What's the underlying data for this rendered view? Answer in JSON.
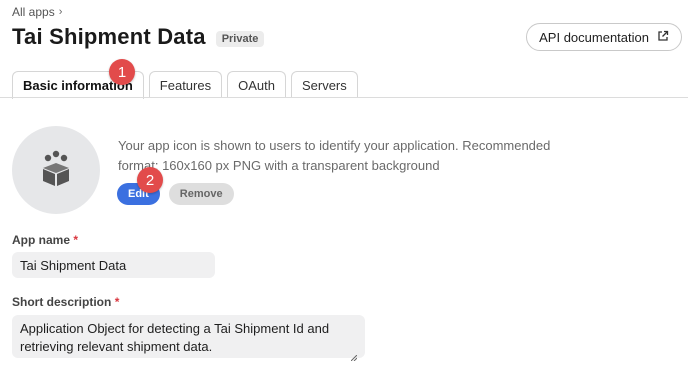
{
  "breadcrumb": {
    "label": "All apps",
    "chevron": "›"
  },
  "title": "Tai Shipment Data",
  "badge": "Private",
  "api_button": {
    "label": "API documentation",
    "icon": "external-link-icon"
  },
  "tabs": [
    {
      "label": "Basic information",
      "active": true
    },
    {
      "label": "Features",
      "active": false
    },
    {
      "label": "OAuth",
      "active": false
    },
    {
      "label": "Servers",
      "active": false
    }
  ],
  "markers": [
    "1",
    "2"
  ],
  "app_icon": {
    "description": "Your app icon is shown to users to identify your application. Recommended format: 160x160 px PNG with a transparent background",
    "edit_label": "Edit",
    "remove_label": "Remove"
  },
  "app_name": {
    "label": "App name",
    "required_mark": "*",
    "value": "Tai Shipment Data"
  },
  "short_description": {
    "label": "Short description",
    "required_mark": "*",
    "value": "Application Object for detecting a Tai Shipment Id and retrieving relevant shipment data."
  },
  "colors": {
    "primary": "#3b70e0",
    "marker": "#e24b4b",
    "required": "#d9363e"
  }
}
